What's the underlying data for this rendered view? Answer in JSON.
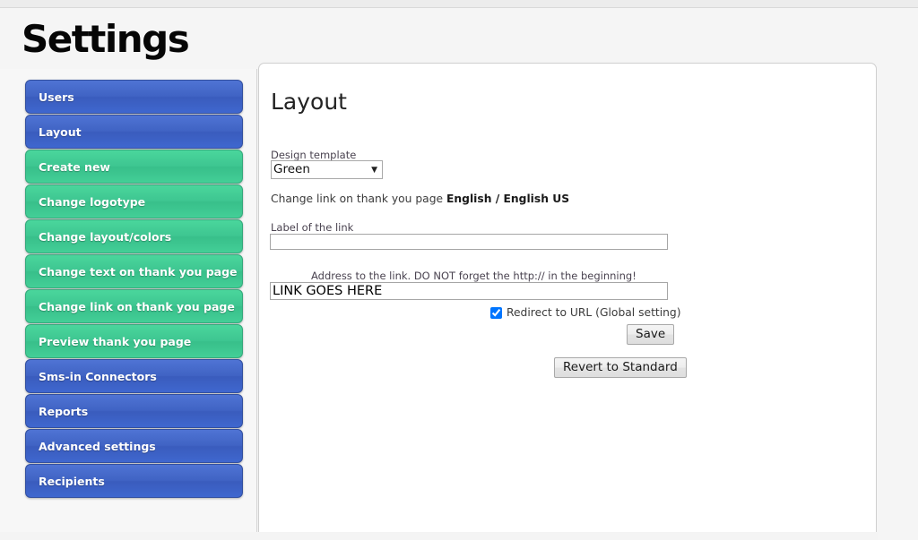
{
  "page": {
    "title": "Settings"
  },
  "sidebar": {
    "items": [
      {
        "label": "Users",
        "color": "blue"
      },
      {
        "label": "Layout",
        "color": "blue"
      },
      {
        "label": "Create new",
        "color": "green"
      },
      {
        "label": "Change logotype",
        "color": "green"
      },
      {
        "label": "Change layout/colors",
        "color": "green"
      },
      {
        "label": "Change text on thank you page",
        "color": "green"
      },
      {
        "label": "Change link on thank you page",
        "color": "green"
      },
      {
        "label": "Preview thank you page",
        "color": "green"
      },
      {
        "label": "Sms-in Connectors",
        "color": "blue"
      },
      {
        "label": "Reports",
        "color": "blue"
      },
      {
        "label": "Advanced settings",
        "color": "blue"
      },
      {
        "label": "Recipients",
        "color": "blue"
      }
    ]
  },
  "content": {
    "heading": "Layout",
    "design_template": {
      "label": "Design template",
      "selected": "Green",
      "options": [
        "Green"
      ],
      "arrow_icon": "chevron-down-icon"
    },
    "change_link_line": {
      "prefix": "Change link on thank you page ",
      "languages": "English / English US"
    },
    "label_of_link": {
      "label": "Label of the link",
      "value": "",
      "placeholder": ""
    },
    "address_to_link": {
      "label": "Address to the link. DO NOT forget the http:// in the beginning!",
      "value": "LINK GOES HERE",
      "placeholder": ""
    },
    "redirect": {
      "label": "Redirect to URL (Global setting)",
      "checked": true
    },
    "save_label": "Save",
    "revert_label": "Revert to Standard"
  },
  "colors": {
    "blue": "#4063c4",
    "green": "#3ec691",
    "panel_bg": "#ffffff",
    "page_bg": "#f5f5f5"
  }
}
